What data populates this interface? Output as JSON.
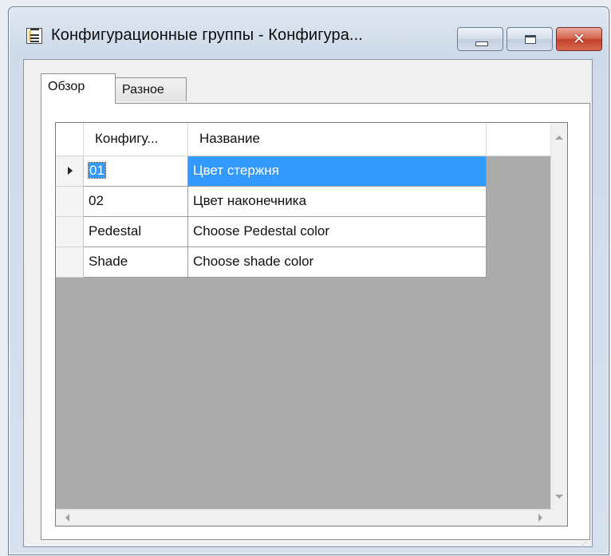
{
  "window": {
    "title": "Конфигурационные группы - Конфигура...",
    "icon": "form-icon",
    "buttons": [
      "minimize",
      "maximize",
      "close"
    ]
  },
  "tabs": [
    {
      "label": "Обзор",
      "active": true
    },
    {
      "label": "Разное",
      "active": false
    }
  ],
  "grid": {
    "columns": [
      "Конфигу...",
      "Название"
    ],
    "rows": [
      {
        "id": "01",
        "name": "Цвет стержня",
        "selected": true
      },
      {
        "id": "02",
        "name": "Цвет наконечника",
        "selected": false
      },
      {
        "id": "Pedestal",
        "name": "Choose Pedestal color",
        "selected": false
      },
      {
        "id": "Shade",
        "name": "Choose shade color",
        "selected": false
      }
    ]
  },
  "colors": {
    "selection": "#3399ff",
    "close_button": "#c3402a",
    "grid_background": "#ababab"
  }
}
